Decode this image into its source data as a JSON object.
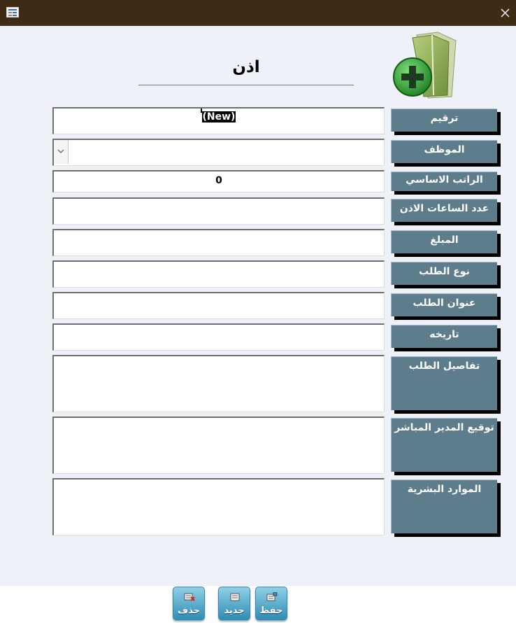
{
  "window": {
    "title_icon": "form-icon",
    "close_icon": "close-icon"
  },
  "form": {
    "title": "اذن",
    "header_icon": "folder-add-icon"
  },
  "fields": [
    {
      "label": "ترقيم",
      "value": "(New)"
    },
    {
      "label": "الموظف",
      "value": ""
    },
    {
      "label": "الراتب الاساسي",
      "value": "0"
    },
    {
      "label": "عدد الساعات الاذن",
      "value": ""
    },
    {
      "label": "المبلغ",
      "value": ""
    },
    {
      "label": "نوع الطلب",
      "value": ""
    },
    {
      "label": "عنوان الطلب",
      "value": ""
    },
    {
      "label": "تاريخه",
      "value": ""
    },
    {
      "label": "تفاصيل الطلب",
      "value": ""
    },
    {
      "label": "توقيع المدير المباشر",
      "value": ""
    },
    {
      "label": "الموارد البشرية",
      "value": ""
    }
  ],
  "buttons": {
    "delete": {
      "label": "حذف",
      "icon": "delete-record-icon"
    },
    "new": {
      "label": "جديد",
      "icon": "new-record-icon"
    },
    "save": {
      "label": "حفظ",
      "icon": "save-record-icon"
    }
  },
  "colors": {
    "titlebar": "#3d2b16",
    "label_bg": "#5d7d8d",
    "form_bg": "#eef2f8"
  }
}
